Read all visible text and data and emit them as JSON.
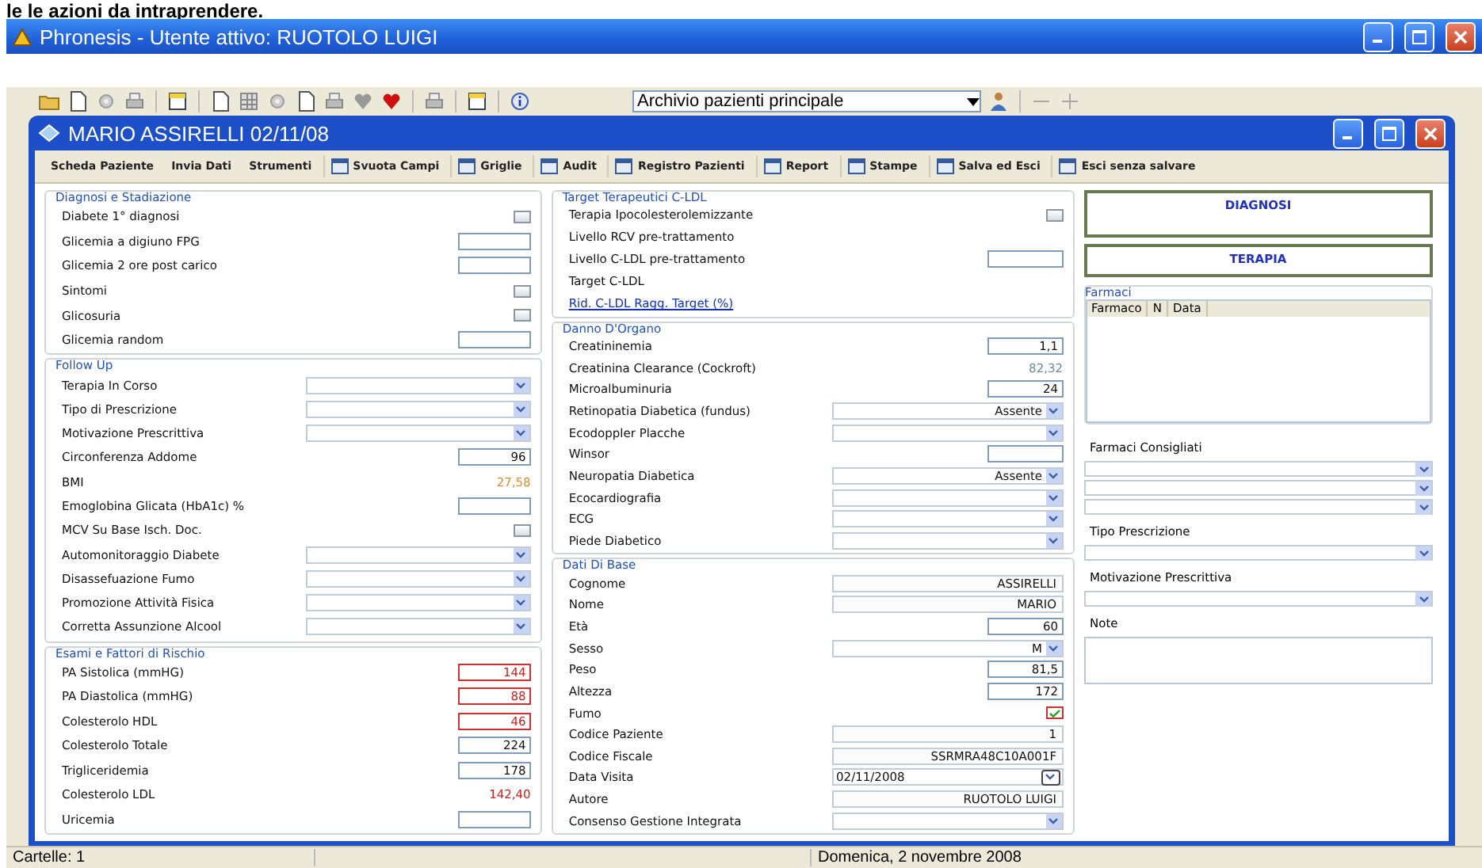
{
  "caption": "le le azioni da intraprendere.",
  "app_window": {
    "title": "Phronesis - Utente attivo: RUOTOLO LUIGI",
    "archive_select": "Archivio pazienti principale"
  },
  "patient_window": {
    "title": "MARIO ASSIRELLI 02/11/08"
  },
  "menu": [
    {
      "label": "Scheda Paziente",
      "kind": "text"
    },
    {
      "label": "Invia Dati",
      "kind": "text"
    },
    {
      "label": "Strumenti",
      "kind": "text"
    },
    {
      "label": "Svuota Campi",
      "kind": "icon"
    },
    {
      "label": "Griglie",
      "kind": "icon"
    },
    {
      "label": "Audit",
      "kind": "icon"
    },
    {
      "label": "Registro Pazienti",
      "kind": "icon"
    },
    {
      "label": "Report",
      "kind": "icon"
    },
    {
      "label": "Stampe",
      "kind": "icon"
    },
    {
      "label": "Salva ed Esci",
      "kind": "icon"
    },
    {
      "label": "Esci senza salvare",
      "kind": "icon"
    }
  ],
  "columns": [
    [
      {
        "title": "Diagnosi e Stadiazione",
        "fields": [
          {
            "label": "Diabete 1° diagnosi",
            "kind": "checkbox",
            "checked": false
          },
          {
            "label": "Glicemia a digiuno FPG",
            "kind": "input"
          },
          {
            "label": "Glicemia 2 ore post carico",
            "kind": "input"
          },
          {
            "label": "Sintomi",
            "kind": "checkbox",
            "checked": false
          },
          {
            "label": "Glicosuria",
            "kind": "checkbox",
            "checked": false
          },
          {
            "label": "Glicemia random",
            "kind": "input"
          }
        ]
      },
      {
        "title": "Follow Up",
        "fields": [
          {
            "label": "Terapia In Corso",
            "kind": "select"
          },
          {
            "label": "Tipo di Prescrizione",
            "kind": "select"
          },
          {
            "label": "Motivazione Prescrittiva",
            "kind": "select"
          },
          {
            "label": "Circonferenza Addome",
            "kind": "input",
            "value": "96"
          },
          {
            "label": "BMI",
            "kind": "readout",
            "value": "27,58",
            "color": "#e09030"
          },
          {
            "label": "Emoglobina Glicata (HbA1c) %",
            "kind": "input"
          },
          {
            "label": "MCV Su Base Isch. Doc.",
            "kind": "checkbox",
            "checked": false
          },
          {
            "label": "Automonitoraggio Diabete",
            "kind": "select"
          },
          {
            "label": "Disassefuazione Fumo",
            "kind": "select"
          },
          {
            "label": "Promozione Attività Fisica",
            "kind": "select"
          },
          {
            "label": "Corretta Assunzione Alcool",
            "kind": "select"
          }
        ]
      },
      {
        "title": "Esami e Fattori di Rischio",
        "fields": [
          {
            "label": "PA Sistolica (mmHG)",
            "kind": "input",
            "value": "144",
            "alert": true
          },
          {
            "label": "PA Diastolica (mmHG)",
            "kind": "input",
            "value": "88",
            "alert": true
          },
          {
            "label": "Colesterolo HDL",
            "kind": "input",
            "value": "46",
            "alert": true
          },
          {
            "label": "Colesterolo Totale",
            "kind": "input",
            "value": "224",
            "alert": false
          },
          {
            "label": "Trigliceridemia",
            "kind": "input",
            "value": "178",
            "alert": false
          },
          {
            "label": "Colesterolo LDL",
            "kind": "readout",
            "value": "142,40",
            "color": "#d02020"
          },
          {
            "label": "Uricemia",
            "kind": "input",
            "alert": false
          }
        ]
      }
    ],
    [
      {
        "title": "Target Terapeutici C-LDL",
        "fields": [
          {
            "label": "Terapia Ipocolesterolemizzante",
            "kind": "checkbox",
            "checked": false
          },
          {
            "label": "Livello RCV pre-trattamento",
            "kind": "label"
          },
          {
            "label": "Livello C-LDL pre-trattamento",
            "kind": "input"
          },
          {
            "label": "Target C-LDL",
            "kind": "label"
          },
          {
            "label": "Rid. C-LDL Ragg. Target (%)",
            "kind": "link"
          }
        ]
      },
      {
        "title": "Danno D'Organo",
        "fields": [
          {
            "label": "Creatininemia",
            "kind": "input",
            "value": "1,1"
          },
          {
            "label": "Creatinina Clearance (Cockroft)",
            "kind": "readout",
            "value": "82,32",
            "color": "#6c8c9c"
          },
          {
            "label": "Microalbuminuria",
            "kind": "input",
            "value": "24"
          },
          {
            "label": "Retinopatia Diabetica (fundus)",
            "kind": "select",
            "value": "Assente"
          },
          {
            "label": "Ecodoppler Placche",
            "kind": "select"
          },
          {
            "label": "Winsor",
            "kind": "input"
          },
          {
            "label": "Neuropatia Diabetica",
            "kind": "select",
            "value": "Assente"
          },
          {
            "label": "Ecocardiografia",
            "kind": "select"
          },
          {
            "label": "ECG",
            "kind": "select"
          },
          {
            "label": "Piede Diabetico",
            "kind": "select"
          }
        ]
      },
      {
        "title": "Dati Di Base",
        "fields": [
          {
            "label": "Cognome",
            "kind": "text",
            "value": "ASSIRELLI"
          },
          {
            "label": "Nome",
            "kind": "text",
            "value": "MARIO"
          },
          {
            "label": "Età",
            "kind": "input",
            "value": "60"
          },
          {
            "label": "Sesso",
            "kind": "select",
            "value": "M"
          },
          {
            "label": "Peso",
            "kind": "input",
            "value": "81,5"
          },
          {
            "label": "Altezza",
            "kind": "input",
            "value": "172"
          },
          {
            "label": "Fumo",
            "kind": "checkbox",
            "checked": true
          },
          {
            "label": "Codice Paziente",
            "kind": "text",
            "value": "1"
          },
          {
            "label": "Codice Fiscale",
            "kind": "text",
            "value": "SSRMRA48C10A001F"
          },
          {
            "label": "Data Visita",
            "kind": "date",
            "value": "02/11/2008"
          },
          {
            "label": "Autore",
            "kind": "text",
            "value": "RUOTOLO LUIGI"
          },
          {
            "label": "Consenso Gestione Integrata",
            "kind": "select"
          }
        ]
      }
    ]
  ],
  "side": {
    "buttons": [
      "DIAGNOSI",
      "TERAPIA"
    ],
    "drugs": {
      "title": "Farmaci",
      "columns": [
        "Farmaco",
        "N",
        "Data"
      ]
    },
    "fields": [
      {
        "kind": "heading",
        "label": "Farmaci Consigliati"
      },
      {
        "kind": "select"
      },
      {
        "kind": "select"
      },
      {
        "kind": "select"
      },
      {
        "kind": "heading",
        "label": "Tipo Prescrizione"
      },
      {
        "kind": "select"
      },
      {
        "kind": "heading",
        "label": "Motivazione Prescrittiva"
      },
      {
        "kind": "select"
      },
      {
        "kind": "heading",
        "label": "Note"
      },
      {
        "kind": "textarea"
      }
    ]
  },
  "status_bar": [
    "Cartelle: 1",
    "Domenica, 2 novembre 2008"
  ]
}
